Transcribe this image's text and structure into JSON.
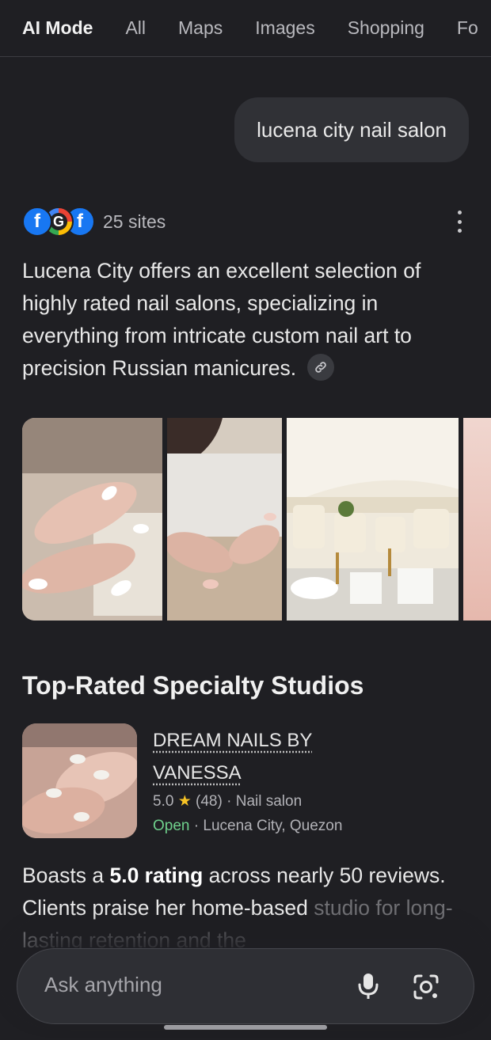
{
  "tabs": [
    "AI Mode",
    "All",
    "Maps",
    "Images",
    "Shopping",
    "Fo"
  ],
  "query": "lucena city nail salon",
  "sources": {
    "count_label": "25 sites",
    "icons": [
      "facebook-icon",
      "google-icon",
      "facebook-icon"
    ],
    "icon_glyphs": {
      "facebook": "f",
      "google": "G"
    }
  },
  "summary": {
    "text": "Lucena City offers an excellent selection of highly rated nail salons, specializing in everything from intricate custom nail art to precision Russian manicures."
  },
  "section_title": "Top-Rated Specialty Studios",
  "place": {
    "name": "DREAM NAILS BY VANESSA",
    "rating": "5.0",
    "star": "★",
    "reviews": "(48)",
    "separator": "·",
    "category": "Nail salon",
    "status": "Open",
    "location": "Lucena City, Quezon"
  },
  "description": {
    "pre": "Boasts a ",
    "bold": "5.0 rating",
    "post": " across nearly 50 reviews. Clients praise her home-based ",
    "faded": "studio for long-lasting retention and the"
  },
  "ask_bar": {
    "placeholder": "Ask anything"
  },
  "colors": {
    "background": "#1f1f23",
    "open_status": "#6fd08c",
    "star": "#f7c325",
    "facebook": "#1877f2"
  }
}
